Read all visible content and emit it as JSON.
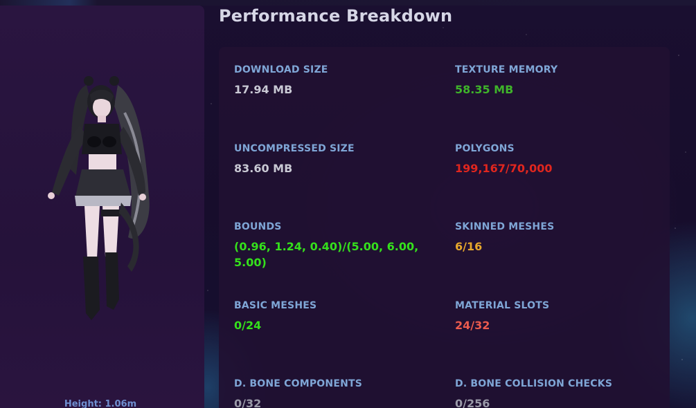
{
  "title": "Performance Breakdown",
  "avatar": {
    "height_label": "Height: 1.06m"
  },
  "stats": {
    "download_size": {
      "label": "DOWNLOAD SIZE",
      "value": "17.94 MB",
      "color": "#c9c9d4"
    },
    "texture_memory": {
      "label": "TEXTURE MEMORY",
      "value": "58.35 MB",
      "color": "#3fb42a"
    },
    "uncompressed": {
      "label": "UNCOMPRESSED SIZE",
      "value": "83.60 MB",
      "color": "#c9c9d4"
    },
    "polygons": {
      "label": "POLYGONS",
      "value": "199,167/70,000",
      "color": "#e0261e"
    },
    "bounds": {
      "label": "BOUNDS",
      "value": "(0.96, 1.24, 0.40)/(5.00, 6.00, 5.00)",
      "color": "#35e01c"
    },
    "skinned_meshes": {
      "label": "SKINNED MESHES",
      "value": "6/16",
      "color": "#e6a72c"
    },
    "basic_meshes": {
      "label": "BASIC MESHES",
      "value": "0/24",
      "color": "#35e01c"
    },
    "material_slots": {
      "label": "MATERIAL SLOTS",
      "value": "24/32",
      "color": "#ec5b4e"
    },
    "dbone_components": {
      "label": "D. BONE COMPONENTS",
      "value": "0/32",
      "color": "#9a9aa8"
    },
    "dbone_collision": {
      "label": "D. BONE COLLISION CHECKS",
      "value": "0/256",
      "color": "#9a9aa8"
    }
  }
}
